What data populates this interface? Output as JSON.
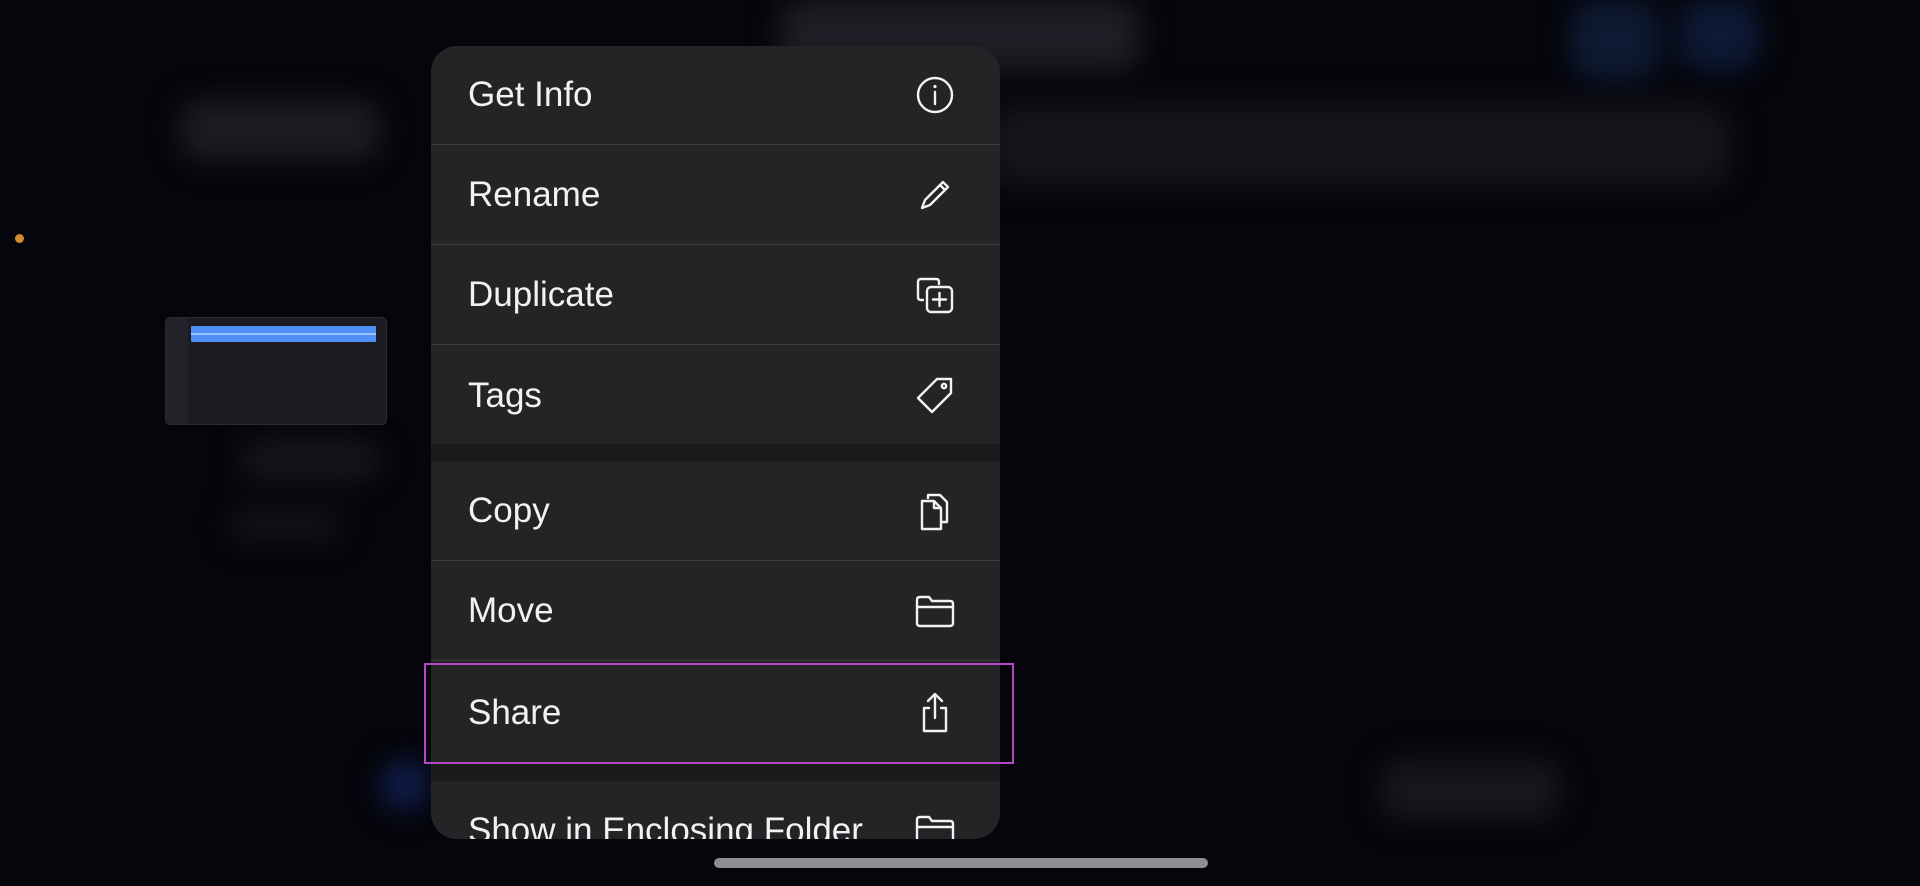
{
  "menu": {
    "items": [
      {
        "label": "Get Info",
        "icon": "info-circle-icon"
      },
      {
        "label": "Rename",
        "icon": "pencil-icon"
      },
      {
        "label": "Duplicate",
        "icon": "duplicate-plus-icon"
      },
      {
        "label": "Tags",
        "icon": "tag-icon"
      },
      {
        "label": "Copy",
        "icon": "copy-documents-icon"
      },
      {
        "label": "Move",
        "icon": "folder-icon"
      },
      {
        "label": "Share",
        "icon": "share-icon"
      },
      {
        "label": "Show in Enclosing Folder",
        "icon": "folder-icon"
      }
    ],
    "highlighted": "Share"
  },
  "colors": {
    "menu_background": "#242427",
    "highlight_border": "#b549c5",
    "track_blue": "#4f8ff7",
    "indicator_dot": "#d68a2e"
  }
}
